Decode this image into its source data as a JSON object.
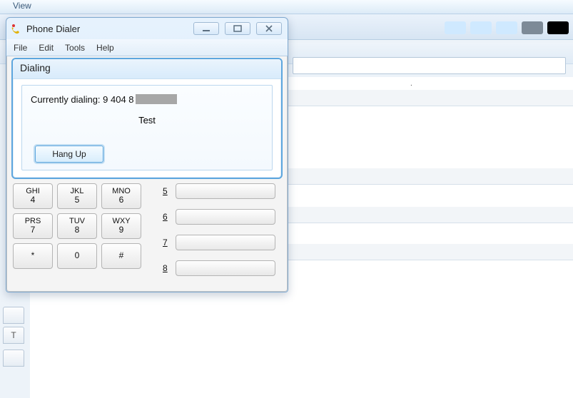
{
  "background": {
    "menu_label": "View",
    "dot": "."
  },
  "dialer": {
    "title": "Phone Dialer",
    "menu": {
      "file": "File",
      "edit": "Edit",
      "tools": "Tools",
      "help": "Help"
    },
    "dialog": {
      "heading": "Dialing",
      "currently_prefix": "Currently dialing: ",
      "number_visible": "9 404 8",
      "contact": "Test",
      "hangup": "Hang Up"
    },
    "keys": {
      "ghi": "GHI",
      "jkl": "JKL",
      "mno": "MNO",
      "prs": "PRS",
      "tuv": "TUV",
      "wxy": "WXY",
      "d4": "4",
      "d5": "5",
      "d6": "6",
      "d7": "7",
      "d8": "8",
      "d9": "9",
      "star": "*",
      "d0": "0",
      "hash": "#"
    },
    "speed": {
      "n5": "5",
      "n6": "6",
      "n7": "7",
      "n8": "8"
    }
  },
  "sidetab": {
    "t": "T"
  }
}
